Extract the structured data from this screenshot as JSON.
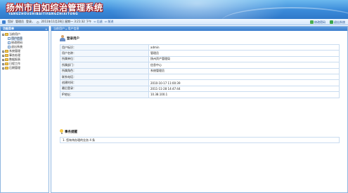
{
  "app": {
    "title": "扬州市自如综治管理系统",
    "subtitle": "YANGZHOUSHIBAITIFANGZHIXITONG"
  },
  "statusbar": {
    "welcome_prefix": "您好",
    "username": "管理员",
    "welcome_suffix": "登录，",
    "datetime": "2011年11月28日 星期一 3:21:32 下午",
    "back_label": "后退",
    "forward_label": "前进",
    "change_password_label": "修改密码",
    "logout_label": "退出系统"
  },
  "sidebar": {
    "title": "功能菜单",
    "toggle": "«",
    "items": [
      {
        "label": "当前用户",
        "expanded": "−"
      },
      {
        "label": "用户信息"
      },
      {
        "label": "修改密码"
      },
      {
        "label": "退出系统"
      },
      {
        "label": "系统管理",
        "expanded": "+"
      },
      {
        "label": "事务处理",
        "expanded": "+"
      },
      {
        "label": "数据报表",
        "expanded": "+"
      },
      {
        "label": "日程工作",
        "expanded": "+"
      },
      {
        "label": "后期管理",
        "expanded": "+"
      }
    ]
  },
  "main": {
    "breadcrumb_root": "当前用户",
    "breadcrumb_sep": "»",
    "breadcrumb_current": "用户信息",
    "section_user_title": "登录用户",
    "rows": [
      {
        "key": "用户标识：",
        "value": "admin"
      },
      {
        "key": "用户名称：",
        "value": "管理员"
      },
      {
        "key": "所属单位：",
        "value": "扬州资产管理局"
      },
      {
        "key": "所属部门：",
        "value": "信息中心"
      },
      {
        "key": "所属角色：",
        "value": "系统管理员"
      },
      {
        "key": "联系电话：",
        "value": ""
      },
      {
        "key": "创建时间：",
        "value": "2010-10-17 11:00:39"
      },
      {
        "key": "最后登录：",
        "value": "2011-11-28 14:47:44"
      },
      {
        "key": "IP地址：",
        "value": "10.38.100.1"
      }
    ],
    "section_notice_title": "事务提醒",
    "notice_text": "1. 您有待办理的业务 4 条"
  }
}
